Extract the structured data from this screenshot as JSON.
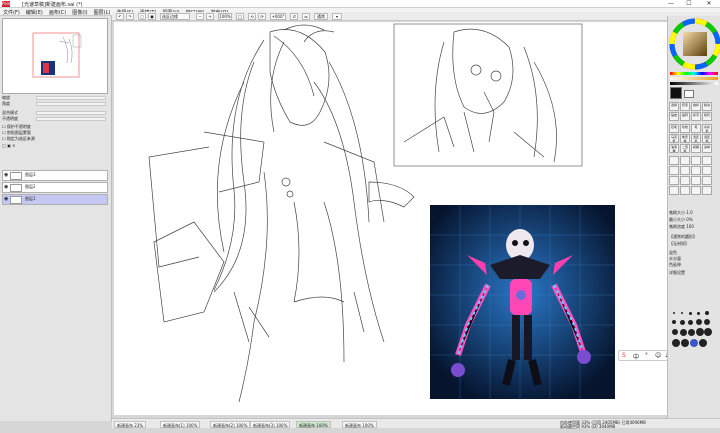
{
  "titlebar": {
    "app": "PaintTool SAI",
    "title": "[光速草稿]新建画布.sai (*)",
    "minimize": "—",
    "maximize": "☐",
    "close": "✕"
  },
  "menubar": [
    "文件(F)",
    "编辑(E)",
    "画布(C)",
    "图像(I)",
    "图层(L)",
    "选择(S)",
    "滤镜(T)",
    "视图(V)",
    "窗口(W)",
    "其他(O)"
  ],
  "toolbar": {
    "checkbox_label": "选区边缘",
    "zoom_value": "100%",
    "angle_value": "+000°",
    "normal_label": "通常"
  },
  "leftpanel": {
    "zoom_label": "缩放",
    "zoom_value": "100.0%",
    "angle_label": "角度",
    "angle_value": "+0000",
    "layer_mode_label": "混合模式",
    "layer_mode_value": "正常",
    "opacity_label": "不透明度",
    "opacity_value": "100%",
    "protect_label": "保护不透明度",
    "clip_label": "剪贴图层蒙版",
    "ref_label": "指定为选区来源",
    "layers": [
      {
        "name": "图层3",
        "mode": "正常"
      },
      {
        "name": "图层2",
        "mode": "正常"
      },
      {
        "name": "图层1",
        "mode": "正常"
      }
    ]
  },
  "statusbar": {
    "tabs": [
      {
        "label": "新建画布",
        "zoom": "23%"
      },
      {
        "label": "新建画布(1)",
        "zoom": "100%"
      },
      {
        "label": "新建画布(2)",
        "zoom": "100%"
      },
      {
        "label": "新建画布(3)",
        "zoom": "100%"
      },
      {
        "label": "新建画布",
        "zoom": "100%"
      },
      {
        "label": "新建画布",
        "zoom": "100%"
      }
    ],
    "memory": "内存使用量 33% (可用 2405MB) 已用4096MB",
    "drive": "驱动器空间 93% (D) 3040MB"
  },
  "rightpanel": {
    "color_mode": "HSV",
    "tools": [
      "选择",
      "套索",
      "魔棒",
      "移动",
      "缩放",
      "旋转",
      "抓手",
      "吸管"
    ],
    "brush_tools": [
      "铅笔",
      "喷枪",
      "笔",
      "水彩笔",
      "马克笔",
      "橡皮擦",
      "选区笔",
      "选区擦",
      "油漆桶",
      "二值笔",
      "模糊",
      "涂抹"
    ],
    "brush_size_label": "笔刷大小",
    "brush_size_value": "1.0",
    "min_size_label": "最小大小",
    "min_size_value": "0%",
    "density_label": "笔刷浓度",
    "density_value": "100",
    "shape_label": "【通常的圆形】",
    "texture_label": "【无材质】",
    "blend_label": "混色",
    "water_label": "水分量",
    "keep_label": "色延伸",
    "adv_label": "详细设置"
  },
  "ime": {
    "label": "中"
  }
}
